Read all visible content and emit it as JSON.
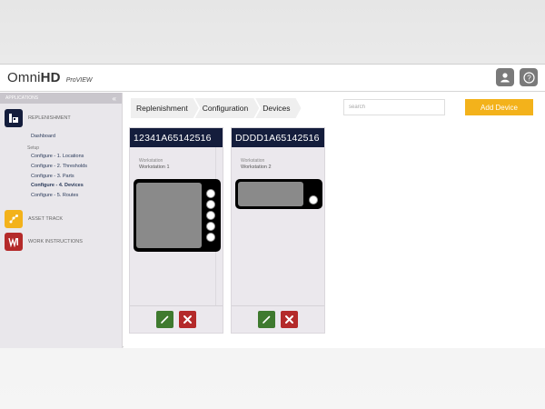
{
  "app": {
    "logo_omni": "OmniHD",
    "logo_omni_prefix": "Omni",
    "logo_omni_suffix": "HD",
    "logo_product": "ProVIEW"
  },
  "topbar": {
    "icons": [
      "user-icon",
      "help-icon"
    ]
  },
  "sidebar": {
    "header": "APPLICATIONS",
    "collapse_glyph": "«",
    "sections": [
      {
        "label": "REPLENISHMENT",
        "icon": "replenishment-icon",
        "color": "#141d3c"
      },
      {
        "label": "ASSET TRACK",
        "icon": "asset-track-icon",
        "color": "#f3b21b"
      },
      {
        "label": "WORK INSTRUCTIONS",
        "icon": "work-instructions-icon",
        "color": "#b42a2a"
      }
    ],
    "dashboard": "Dashboard",
    "setup_label": "Setup",
    "config_items": [
      {
        "label": "Configure - 1. Locations",
        "active": false
      },
      {
        "label": "Configure - 2. Thresholds",
        "active": false
      },
      {
        "label": "Configure - 3. Parts",
        "active": false
      },
      {
        "label": "Configure - 4. Devices",
        "active": true
      },
      {
        "label": "Configure - 5. Routes",
        "active": false
      }
    ]
  },
  "breadcrumb": [
    "Replenishment",
    "Configuration",
    "Devices"
  ],
  "search": {
    "placeholder": "search",
    "value": ""
  },
  "toolbar": {
    "add_label": "Add Device"
  },
  "devices": [
    {
      "id": "12341A65142516",
      "ws_label": "Workstation",
      "ws_value": "Workstation 1",
      "type": "tall",
      "buttons": 5
    },
    {
      "id": "DDDD1A65142516",
      "ws_label": "Workstation",
      "ws_value": "Workstation 2",
      "type": "small",
      "buttons": 1
    }
  ],
  "colors": {
    "header_navy": "#141d3c",
    "accent_yellow": "#f3b21b",
    "edit_green": "#3f7a2f",
    "delete_red": "#b42a2a"
  }
}
